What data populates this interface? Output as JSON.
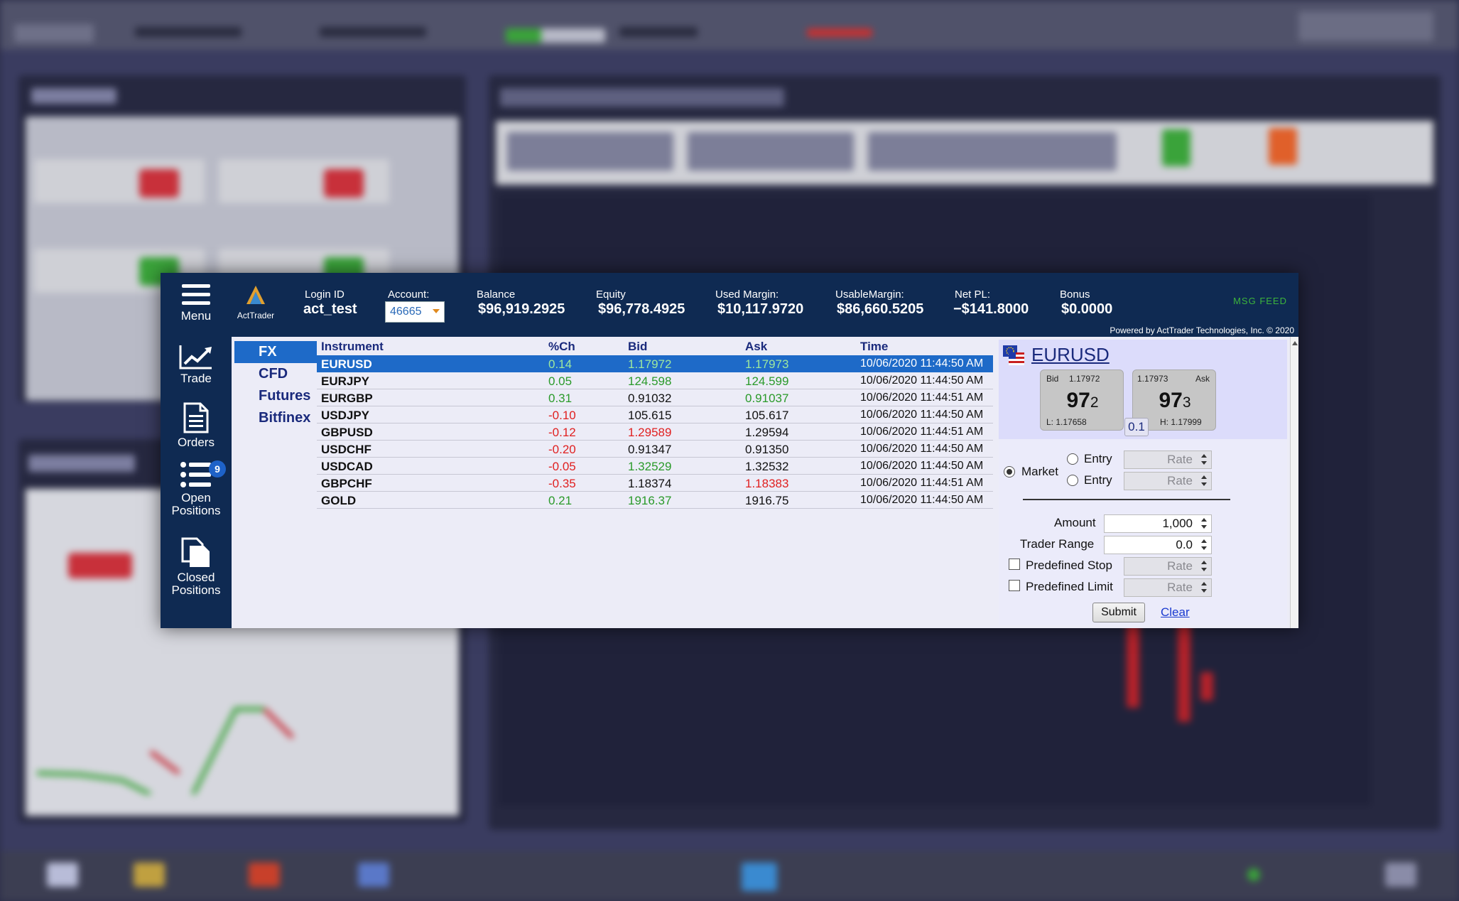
{
  "sidebar": {
    "items": [
      {
        "label": "Menu",
        "icon": "hamburger-icon"
      },
      {
        "label": "Trade",
        "icon": "trend-chart-icon"
      },
      {
        "label": "Orders",
        "icon": "document-icon"
      },
      {
        "label": "Open Positions",
        "line1": "Open",
        "line2": "Positions",
        "icon": "list-icon",
        "badge": "9"
      },
      {
        "label": "Closed Positions",
        "line1": "Closed",
        "line2": "Positions",
        "icon": "documents-icon"
      }
    ]
  },
  "header": {
    "logo_text": "ActTrader",
    "login_id_label": "Login ID",
    "login_id": "act_test",
    "account_label": "Account:",
    "account": "46665",
    "balance_label": "Balance",
    "balance": "$96,919.2925",
    "equity_label": "Equity",
    "equity": "$96,778.4925",
    "used_margin_label": "Used Margin:",
    "used_margin": "$10,117.9720",
    "usable_margin_label": "UsableMargin:",
    "usable_margin": "$86,660.5205",
    "net_pl_label": "Net PL:",
    "net_pl": "−$141.8000",
    "bonus_label": "Bonus",
    "bonus": "$0.0000",
    "msg_feed": "MSG FEED",
    "powered_by": "Powered by ActTrader Technologies, Inc. © 2020"
  },
  "categories": [
    {
      "label": "FX",
      "active": true
    },
    {
      "label": "CFD"
    },
    {
      "label": "Futures"
    },
    {
      "label": "Bitfinex"
    }
  ],
  "quotes": {
    "columns": [
      "Instrument",
      "%Ch",
      "Bid",
      "Ask",
      "Time"
    ],
    "rows": [
      {
        "symbol": "EURUSD",
        "change": "0.14",
        "bid": "1.17972",
        "ask": "1.17973",
        "time": "10/06/2020 11:44:50 AM",
        "selected": true
      },
      {
        "symbol": "EURJPY",
        "change": "0.05",
        "bid": "124.598",
        "ask": "124.599",
        "time": "10/06/2020 11:44:50 AM"
      },
      {
        "symbol": "EURGBP",
        "change": "0.31",
        "bid": "0.91032",
        "ask": "0.91037",
        "time": "10/06/2020 11:44:51 AM"
      },
      {
        "symbol": "USDJPY",
        "change": "-0.10",
        "bid": "105.615",
        "ask": "105.617",
        "time": "10/06/2020 11:44:50 AM"
      },
      {
        "symbol": "GBPUSD",
        "change": "-0.12",
        "bid": "1.29589",
        "ask": "1.29594",
        "time": "10/06/2020 11:44:51 AM"
      },
      {
        "symbol": "USDCHF",
        "change": "-0.20",
        "bid": "0.91347",
        "ask": "0.91350",
        "time": "10/06/2020 11:44:50 AM"
      },
      {
        "symbol": "USDCAD",
        "change": "-0.05",
        "bid": "1.32529",
        "ask": "1.32532",
        "time": "10/06/2020 11:44:50 AM"
      },
      {
        "symbol": "GBPCHF",
        "change": "-0.35",
        "bid": "1.18374",
        "ask": "1.18383",
        "time": "10/06/2020 11:44:51 AM"
      },
      {
        "symbol": "GOLD",
        "change": "0.21",
        "bid": "1916.37",
        "ask": "1916.75",
        "time": "10/06/2020 11:44:50 AM"
      }
    ],
    "colors": {
      "up": "#2a9a2a",
      "down": "#e02020",
      "neutral": "#111111",
      "bid": [
        "#2a9a2a",
        "#2a9a2a",
        "#111111",
        "#111111",
        "#e02020",
        "#111111",
        "#2a9a2a",
        "#111111",
        "#2a9a2a"
      ],
      "ask": [
        "#2a9a2a",
        "#2a9a2a",
        "#2a9a2a",
        "#111111",
        "#111111",
        "#111111",
        "#111111",
        "#e02020",
        "#111111"
      ]
    }
  },
  "ticket": {
    "symbol": "EURUSD",
    "bid_label": "Bid",
    "bid_full": "1.17972",
    "bid_big": "97",
    "bid_pip": "2",
    "low": "L: 1.17658",
    "ask_label": "Ask",
    "ask_full": "1.17973",
    "ask_big": "97",
    "ask_pip": "3",
    "high": "H: 1.17999",
    "spread": "0.1",
    "market_label": "Market",
    "entry_label_1": "Entry",
    "entry_label_2": "Entry",
    "rate_placeholder": "Rate",
    "amount_label": "Amount",
    "amount": "1,000",
    "trader_range_label": "Trader Range",
    "trader_range": "0.0",
    "predefined_stop_label": "Predefined Stop",
    "predefined_limit_label": "Predefined Limit",
    "submit_label": "Submit",
    "clear_label": "Clear"
  }
}
